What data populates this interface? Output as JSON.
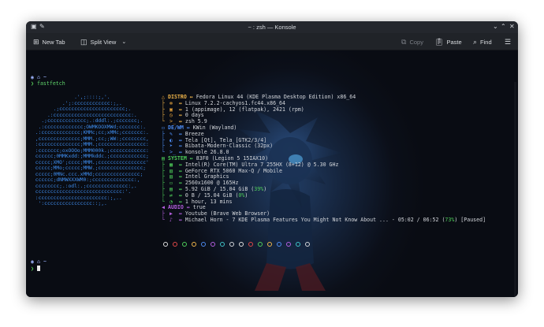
{
  "titlebar": {
    "title": "~ : zsh — Konsole"
  },
  "toolbar": {
    "new_tab": "New Tab",
    "split_view": "Split View",
    "copy": "Copy",
    "paste": "Paste",
    "find": "Find"
  },
  "prompt": {
    "path": "~",
    "command": "fastfetch"
  },
  "ascii_lines": [
    "              .',;::::;,'.",
    "          .';:cccccccccccc:;,.",
    "       .;cccccccccccccccccccccc;.",
    "     .:cccccccccccccccccccccccccc:.",
    "   .;ccccccccccccc;.:dddl:.;ccccccc;.",
    "  .:ccccccccccccc;OWMKOOXMWd;ccccccc:.",
    " .:ccccccccccccc;KMMc;cc;xMMc;ccccccc:.",
    " ,cccccccccccccc;MMM.;cc;;WW:;cccccccc,",
    " :cccccccccccccc;MMM.;cccccccccccccccc:",
    " :ccccccc;oxOOOo;MMM000k.;cccccccccccc:",
    " cccccc;0MMKxdd:;MMMkddc.;cccccccccccc;",
    " ccccc;XMO';cccc;MMM.;cccccccccccccccc'",
    " ccccc;MMo;ccccc;MMW.;ccccccccccccccc;",
    " ccccc;0MNc.ccc.xMMd;ccccccccccccccc;",
    " cccccc;dNMWXXXWM0:;cccccccccccccc:,",
    " cccccccc;.:odl:.;cccccccccccccc:,.",
    " ccccccccccccccccccccccccccccc:'.",
    " :ccccccccccccccccccccccc:;,..",
    "  ':cccccccccccccccc::;,."
  ],
  "info": [
    {
      "kind": "section",
      "color": "orange",
      "icon": "warning-icon",
      "label": "DISTRO",
      "value": "Fedora Linux 44 (KDE Plasma Desktop Edition) x86_64"
    },
    {
      "kind": "item",
      "color": "orange",
      "tree": "├",
      "icon": "gear-icon",
      "value": "Linux 7.2.2-cachyos1.fc44.x86_64"
    },
    {
      "kind": "item",
      "color": "orange",
      "tree": "├",
      "icon": "package-icon",
      "value": "1 (appimage), 12 (flatpak), 2421 (rpm)"
    },
    {
      "kind": "item",
      "color": "orange",
      "tree": "├",
      "icon": "clock-icon",
      "value": "0 days"
    },
    {
      "kind": "item",
      "color": "orange",
      "tree": "└",
      "icon": "terminal-icon",
      "value": "zsh 5.9"
    },
    {
      "kind": "section",
      "color": "blue",
      "icon": "desktop-icon",
      "label": "DE/WM",
      "value": "KWin (Wayland)"
    },
    {
      "kind": "item",
      "color": "blue",
      "tree": "├",
      "icon": "palette-icon",
      "value": "Breeze"
    },
    {
      "kind": "item",
      "color": "blue",
      "tree": "├",
      "icon": "theme-icon",
      "value": "Tela [Qt], Tela [GTK2/3/4]"
    },
    {
      "kind": "item",
      "color": "blue",
      "tree": "├",
      "icon": "cursor-icon",
      "value": "Bibata-Modern-Classic (32px)"
    },
    {
      "kind": "item",
      "color": "blue",
      "tree": "└",
      "icon": "terminal-icon",
      "value": "konsole 26.8.0"
    },
    {
      "kind": "section",
      "color": "green",
      "icon": "computer-icon",
      "label": "SYSTEM",
      "value": "83F0 (Legion 5 15IAX10)"
    },
    {
      "kind": "item",
      "color": "green",
      "tree": "├",
      "icon": "cpu-icon",
      "value": "Intel(R) Core(TM) Ultra 7 255HX (8+12) @ 5.30 GHz"
    },
    {
      "kind": "item",
      "color": "green",
      "tree": "├",
      "icon": "gpu-icon",
      "value": "GeForce RTX 5060 Max-Q / Mobile"
    },
    {
      "kind": "item",
      "color": "green",
      "tree": "├",
      "icon": "gpu-icon",
      "value": "Intel Graphics"
    },
    {
      "kind": "item",
      "color": "green",
      "tree": "├",
      "icon": "monitor-icon",
      "value": "2560x1600 @ 165Hz"
    },
    {
      "kind": "item",
      "color": "green",
      "tree": "├",
      "icon": "memory-icon",
      "value": "5.92 GiB / 15.04 GiB (",
      "pct": "39%",
      "tail": ")"
    },
    {
      "kind": "item",
      "color": "green",
      "tree": "├",
      "icon": "swap-icon",
      "value": "0 B / 15.04 GiB (",
      "pct": "0%",
      "tail": ")"
    },
    {
      "kind": "item",
      "color": "green",
      "tree": "└",
      "icon": "uptime-icon",
      "value": "1 hour, 13 mins"
    },
    {
      "kind": "section",
      "color": "purple",
      "icon": "audio-icon",
      "label": "AUDIO",
      "value": "true"
    },
    {
      "kind": "item",
      "color": "purple",
      "tree": "├",
      "icon": "player-icon",
      "value": "Youtube (Brave Web Browser)"
    },
    {
      "kind": "item",
      "color": "purple",
      "tree": "└",
      "icon": "music-icon",
      "value": "Michael Horn - 7 KDE Plasma Features You Might Not Know About ... - 05:02 / 06:52 (",
      "pct": "73%",
      "tail": ") [Paused]"
    }
  ],
  "palette_dots": [
    "#e0e0e0",
    "#e04848",
    "#4ecf5a",
    "#f0b54a",
    "#4d8cf2",
    "#b55fe0",
    "#3fc3c8",
    "#d3d6db",
    "#e0e0e0",
    "#e04848",
    "#4ecf5a",
    "#f0b54a",
    "#4d8cf2",
    "#b55fe0",
    "#3fc3c8",
    "#d3d6db"
  ],
  "prompt2": {
    "path": "~"
  }
}
